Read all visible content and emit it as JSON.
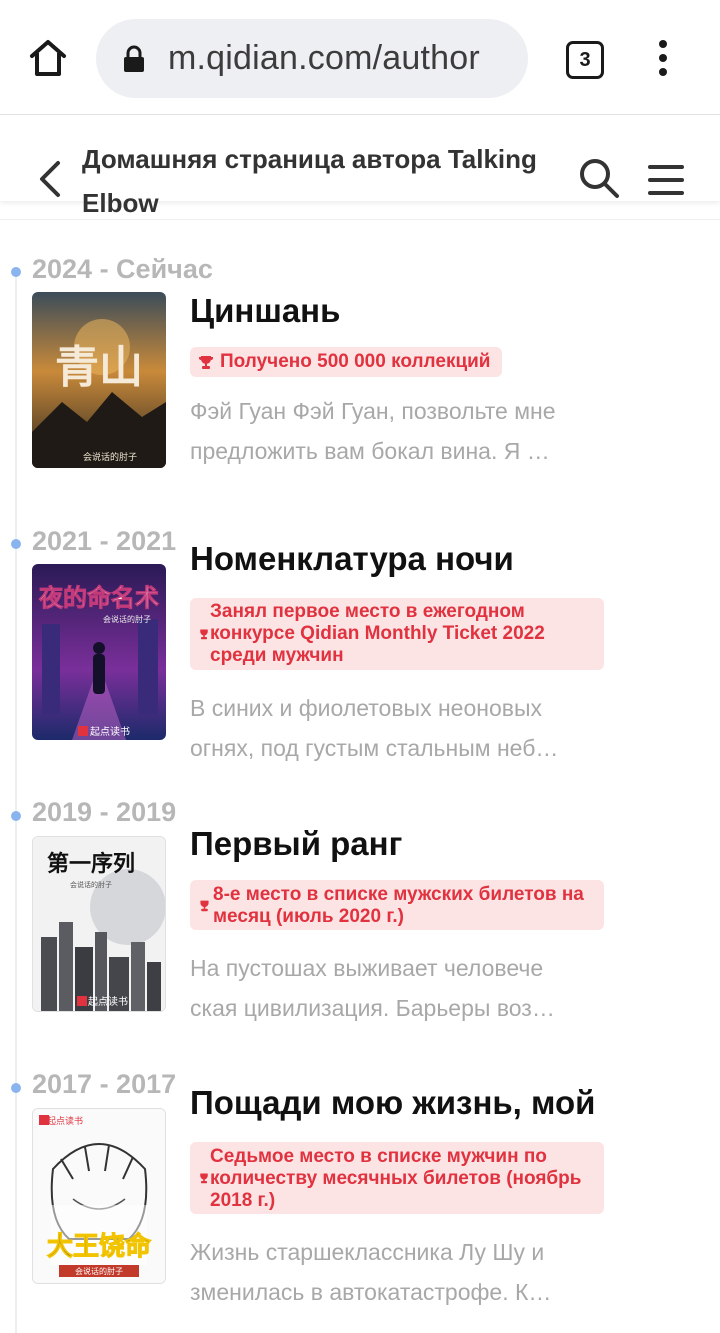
{
  "browser": {
    "url": "m.qidian.com/author",
    "tab_count": "3"
  },
  "header": {
    "title": "Домашняя страница автора Talking Elbow"
  },
  "books": [
    {
      "years": "2024 - Сейчас",
      "title": "Циншань",
      "award": "Получено 500 000 коллекций",
      "desc_line1": "Фэй Гуан Фэй Гуан, позвольте мне",
      "desc_line2": "предложить вам бокал вина. Я …",
      "cover_text": "青山",
      "cover_author": "会说话的肘子"
    },
    {
      "years": "2021 - 2021",
      "title": "Номенклатура ночи",
      "award": "Занял первое место в ежегодном конкурсе Qidian Monthly Ticket 2022 среди мужчин",
      "desc_line1": "В синих и фиолетовых неоновых",
      "desc_line2": "огнях, под густым стальным неб…",
      "cover_text": "夜的命名术",
      "cover_author": "会说话的肘子",
      "cover_brand": "起点读书"
    },
    {
      "years": "2019 - 2019",
      "title": "Первый ранг",
      "award": "8-е место в списке мужских билетов на месяц (июль 2020 г.)",
      "desc_line1": "На пустошах выживает человече",
      "desc_line2": "ская цивилизация. Барьеры воз…",
      "cover_text": "第一序列",
      "cover_author": "会说话的肘子",
      "cover_brand": "起点读书"
    },
    {
      "years": "2017 - 2017",
      "title": "Пощади мою жизнь, мой",
      "award": "Седьмое место в списке мужчин по количеству месячных билетов (ноябрь 2018 г.)",
      "desc_line1": "Жизнь старшеклассника Лу Шу и",
      "desc_line2": "зменилась в автокатастрофе. К…",
      "cover_text": "大王饶命",
      "cover_author": "会说话的肘子",
      "cover_brand": "起点读书"
    }
  ],
  "icons": {
    "home": "home-icon",
    "lock": "lock-icon",
    "back": "chevron-left-icon",
    "search": "search-icon",
    "menu": "hamburger-menu-icon",
    "award": "trophy-icon"
  },
  "colors": {
    "award_text": "#e0323f",
    "award_bg": "#fde4e4",
    "timeline_dot": "#8ab4f0",
    "year_text": "#b7b7b7",
    "desc_text": "#a8a8a8"
  }
}
